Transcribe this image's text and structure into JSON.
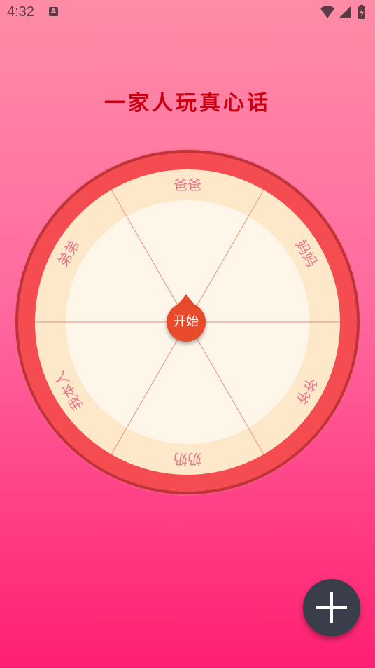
{
  "status_bar": {
    "time": "4:32",
    "notification_icon": "a-icon",
    "notification_glyph": "A",
    "wifi_icon": "wifi-icon",
    "signal_icon": "signal-icon",
    "battery_icon": "battery-charging-icon"
  },
  "title": "一家人玩真心话",
  "wheel": {
    "segments": [
      "爸爸",
      "妈妈",
      "爷爷",
      "奶奶",
      "我本人",
      "弟弟"
    ],
    "start_label": "开始",
    "colors": {
      "outer_ring": "#f54c52",
      "segment_band": "#fde8c9",
      "inner_disc": "#fff6ea",
      "divider": "#e9a08a"
    }
  },
  "fab": {
    "icon": "plus-icon"
  }
}
